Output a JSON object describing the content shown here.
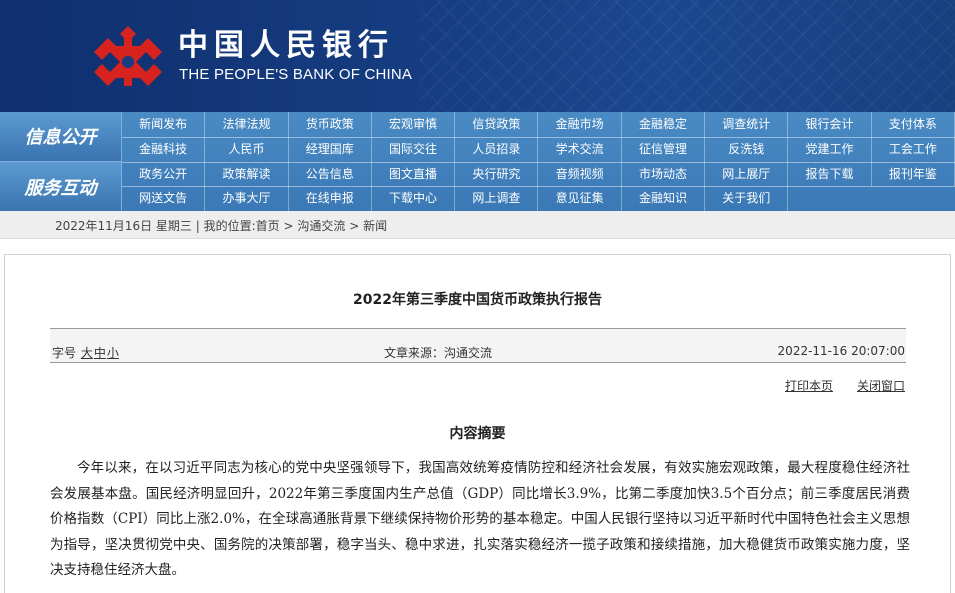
{
  "header": {
    "logo_cn": "中国人民银行",
    "logo_en": "THE PEOPLE'S BANK OF CHINA",
    "colors": {
      "banner": "#163d82",
      "emblem": "#d7231e",
      "nav": "#3f7fbc"
    }
  },
  "nav": {
    "group1_label": "信息公开",
    "group2_label": "服务互动",
    "rows": [
      [
        "新闻发布",
        "法律法规",
        "货币政策",
        "宏观审慎",
        "信贷政策",
        "金融市场",
        "金融稳定",
        "调查统计",
        "银行会计",
        "支付体系"
      ],
      [
        "金融科技",
        "人民币",
        "经理国库",
        "国际交往",
        "人员招录",
        "学术交流",
        "征信管理",
        "反洗钱",
        "党建工作",
        "工会工作"
      ],
      [
        "政务公开",
        "政策解读",
        "公告信息",
        "图文直播",
        "央行研究",
        "音频视频",
        "市场动态",
        "网上展厅",
        "报告下载",
        "报刊年鉴"
      ],
      [
        "网送文告",
        "办事大厅",
        "在线申报",
        "下载中心",
        "网上调查",
        "意见征集",
        "金融知识",
        "关于我们"
      ]
    ]
  },
  "breadcrumb": {
    "date": "2022年11月16日 星期三",
    "sep": "|",
    "prefix": "我的位置:",
    "home": "首页",
    "arrow1": ">",
    "level1": "沟通交流",
    "arrow2": ">",
    "level2": "新闻"
  },
  "article": {
    "title": "2022年第三季度中国货币政策执行报告",
    "font_label": "字号",
    "font_large": "大",
    "font_medium": "中",
    "font_small": "小",
    "source": "文章来源：沟通交流",
    "datetime": "2022-11-16 20:07:00",
    "print_label": "打印本页",
    "close_label": "关闭窗口",
    "section_title": "内容摘要",
    "paragraph": "今年以来，在以习近平同志为核心的党中央坚强领导下，我国高效统筹疫情防控和经济社会发展，有效实施宏观政策，最大程度稳住经济社会发展基本盘。国民经济明显回升，2022年第三季度国内生产总值（GDP）同比增长3.9%，比第二季度加快3.5个百分点；前三季度居民消费价格指数（CPI）同比上涨2.0%，在全球高通胀背景下继续保持物价形势的基本稳定。中国人民银行坚持以习近平新时代中国特色社会主义思想为指导，坚决贯彻党中央、国务院的决策部署，稳字当头、稳中求进，扎实落实稳经济一揽子政策和接续措施，加大稳健货币政策实施力度，坚决支持稳住经济大盘。"
  }
}
